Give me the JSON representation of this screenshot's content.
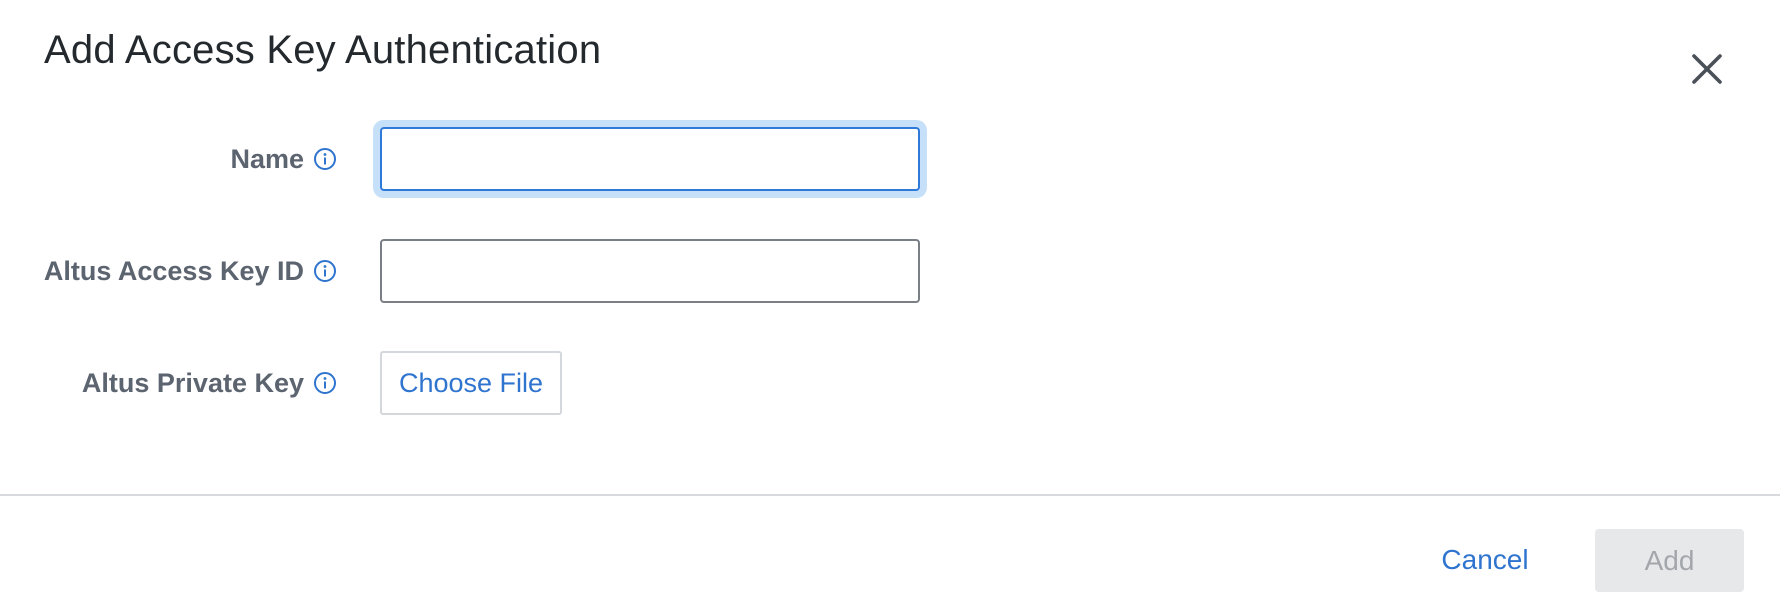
{
  "dialog": {
    "title": "Add Access Key Authentication",
    "close_icon": "close-icon"
  },
  "form": {
    "name": {
      "label": "Name",
      "value": "",
      "info_icon": "info-circle-icon"
    },
    "access_key_id": {
      "label": "Altus Access Key ID",
      "value": "",
      "info_icon": "info-circle-icon"
    },
    "private_key": {
      "label": "Altus Private Key",
      "button_label": "Choose File",
      "info_icon": "info-circle-icon"
    }
  },
  "footer": {
    "cancel_label": "Cancel",
    "add_label": "Add",
    "add_disabled": true
  },
  "colors": {
    "accent": "#2f74cf",
    "focus_ring": "#c7e0fa",
    "label": "#5c6470",
    "disabled_bg": "#e6e8ea",
    "disabled_text": "#a3a7ac"
  }
}
